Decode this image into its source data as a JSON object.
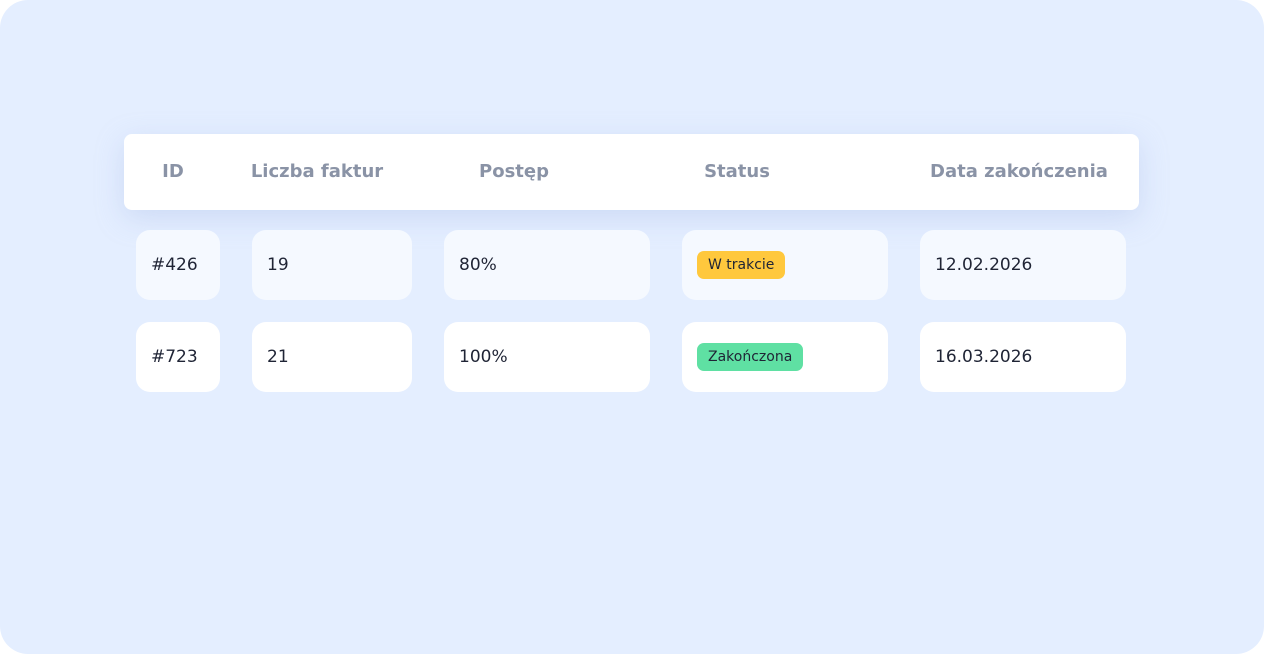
{
  "table": {
    "columns": [
      "ID",
      "Liczba faktur",
      "Postęp",
      "Status",
      "Data zakończenia"
    ],
    "rows": [
      {
        "id": "#426",
        "invoice_count": "19",
        "progress": "80%",
        "status": "W trakcie",
        "status_color": "#ffc83d",
        "end_date": "12.02.2026"
      },
      {
        "id": "#723",
        "invoice_count": "21",
        "progress": "100%",
        "status": "Zakończona",
        "status_color": "#5fe0a3",
        "end_date": "16.03.2026"
      }
    ]
  },
  "colors": {
    "background": "#e4eeff",
    "header_text": "#8a93a6",
    "cell_text": "#1f2435"
  }
}
